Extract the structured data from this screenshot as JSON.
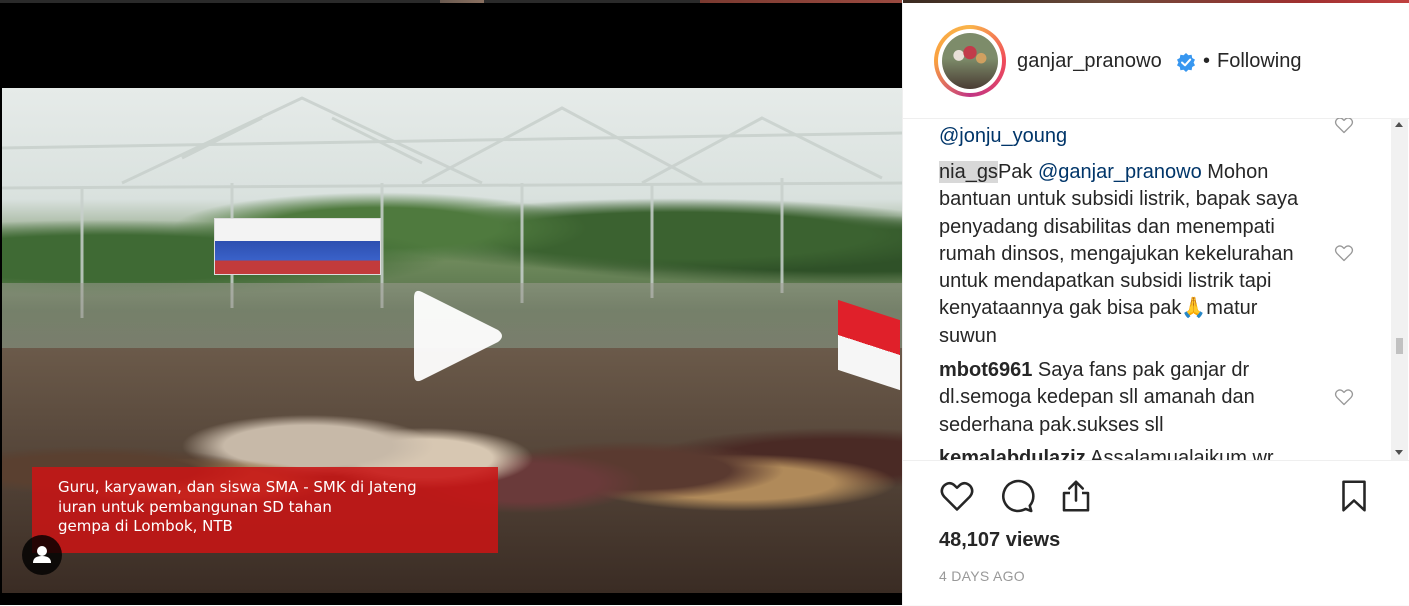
{
  "video": {
    "caption": "Guru, karyawan, dan siswa SMA - SMK di Jateng\niuran untuk pembangunan SD tahan\ngempa di Lombok, NTB",
    "play_icon": "play-icon",
    "user_tag_icon": "user-icon"
  },
  "post_header": {
    "username": "ganjar_pranowo",
    "verified_icon": "verified-badge-icon",
    "separator": "•",
    "follow_status": "Following"
  },
  "comments": [
    {
      "author": "",
      "text": "",
      "mention": "@jonju_young"
    },
    {
      "author": "nia_gs",
      "pre": "Pak ",
      "mention": "@ganjar_pranowo",
      "text": " Mohon bantuan untuk subsidi listrik, bapak saya penyadang disabilitas dan menempati rumah dinsos, mengajukan kekelurahan untuk mendapatkan subsidi listrik tapi kenyataannya gak bisa pak🙏matur suwun"
    },
    {
      "author": "mbot6961",
      "text": " Saya fans pak ganjar dr dl.semoga kedepan sll amanah dan sederhana pak.sukses sll"
    },
    {
      "author": "kemalabdulaziz",
      "text": " Assalamualaikum wr"
    }
  ],
  "actions": {
    "like_icon": "heart-icon",
    "comment_icon": "comment-icon",
    "share_icon": "share-icon",
    "save_icon": "bookmark-icon"
  },
  "stats": {
    "views": "48,107 views",
    "time_ago": "4 DAYS AGO"
  },
  "colors": {
    "caption_bg": "#c81414",
    "mention": "#003569",
    "verified": "#3897f0",
    "text": "#262626",
    "muted": "#999999"
  }
}
